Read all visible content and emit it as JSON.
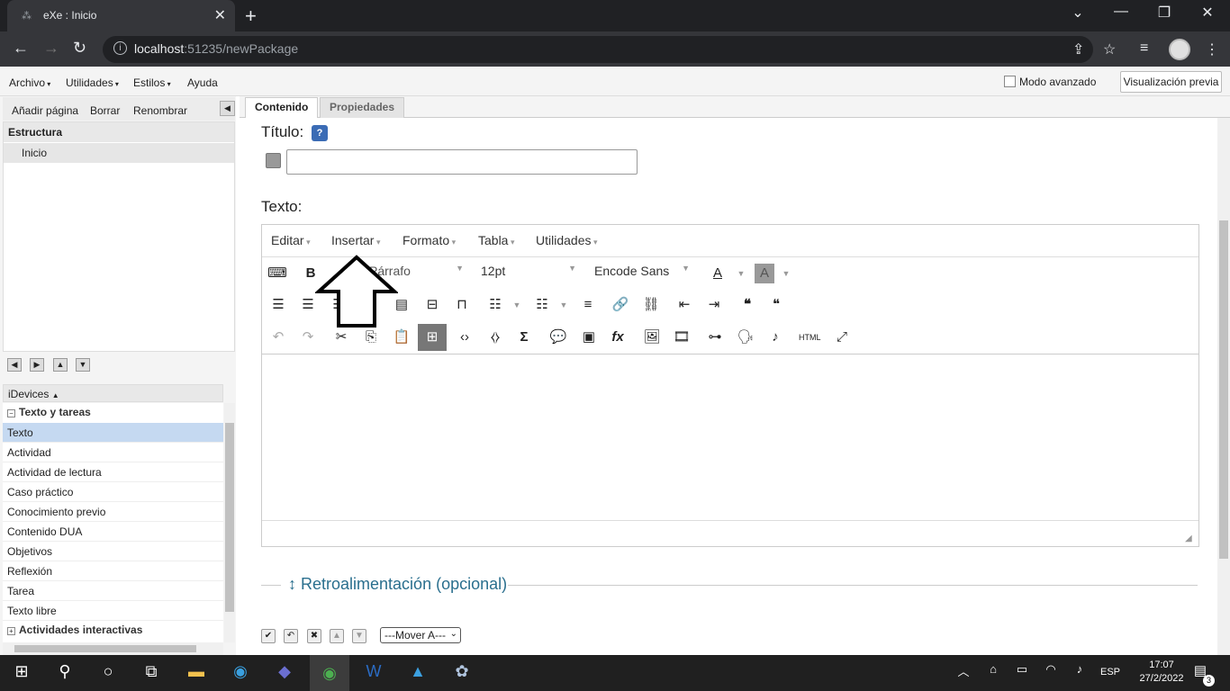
{
  "browser": {
    "tab_title": "eXe : Inicio",
    "url_host": "localhost",
    "url_path": ":51235/newPackage"
  },
  "menubar": {
    "items": [
      "Archivo",
      "Utilidades",
      "Estilos",
      "Ayuda"
    ],
    "advanced_mode": "Modo avanzado",
    "preview": "Visualización previa"
  },
  "left_panel": {
    "toolbar": [
      "Añadir página",
      "Borrar",
      "Renombrar"
    ],
    "structure_header": "Estructura",
    "pages": [
      "Inicio"
    ],
    "idevices_header": "iDevices",
    "groups": [
      {
        "name": "Texto y tareas",
        "items": [
          "Texto",
          "Actividad",
          "Actividad de lectura",
          "Caso práctico",
          "Conocimiento previo",
          "Contenido DUA",
          "Objetivos",
          "Reflexión",
          "Tarea",
          "Texto libre"
        ]
      },
      {
        "name": "Actividades interactivas"
      }
    ],
    "selected": "Texto"
  },
  "tabs": [
    "Contenido",
    "Propiedades"
  ],
  "form": {
    "title_label": "Título:",
    "text_label": "Texto:",
    "feedback": "↕ Retroalimentación (opcional)",
    "move_select": "---Mover A---"
  },
  "editor": {
    "menus": [
      "Editar",
      "Insertar",
      "Formato",
      "Tabla",
      "Utilidades"
    ],
    "block_format": "Párrafo",
    "font_size": "12pt",
    "font_family": "Encode Sans"
  },
  "taskbar": {
    "lang": "ESP",
    "time": "17:07",
    "date": "27/2/2022",
    "notifications": "3"
  }
}
